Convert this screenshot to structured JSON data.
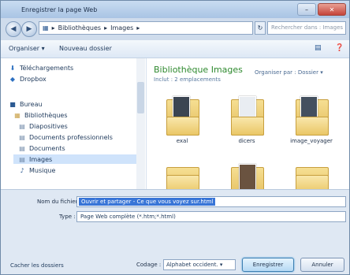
{
  "window": {
    "title": "Enregistrer la page Web"
  },
  "address": {
    "crumbs": [
      "Bibliothèques",
      "Images"
    ],
    "search_placeholder": "Rechercher dans : Images"
  },
  "toolbar": {
    "organize": "Organiser ▾",
    "new_folder": "Nouveau dossier"
  },
  "nav": {
    "items": [
      {
        "label": "Téléchargements",
        "icon": "download-folder-icon"
      },
      {
        "label": "Dropbox",
        "icon": "dropbox-icon"
      },
      {
        "label": "Bureau",
        "icon": "desktop-icon"
      },
      {
        "label": "Bibliothèques",
        "icon": "library-icon"
      },
      {
        "label": "Diapositives",
        "icon": "library-icon"
      },
      {
        "label": "Documents professionnels",
        "icon": "library-icon"
      },
      {
        "label": "Documents",
        "icon": "library-icon"
      },
      {
        "label": "Images",
        "icon": "library-icon"
      },
      {
        "label": "Musique",
        "icon": "music-icon"
      }
    ],
    "selected": "Images"
  },
  "library": {
    "title": "Bibliothèque Images",
    "subtitle": "Inclut : 2 emplacements",
    "arrange_label": "Organiser par :",
    "arrange_value": "Dossier ▾",
    "folders": [
      {
        "label": "exal"
      },
      {
        "label": "dicers"
      },
      {
        "label": "image_voyager"
      },
      {
        "label": ""
      },
      {
        "label": ""
      },
      {
        "label": ""
      }
    ]
  },
  "form": {
    "filename_label": "Nom du fichier :",
    "filename_value": "Ouvrir et partager - Ce que vous voyez sur.html",
    "type_label": "Type :",
    "type_value": "Page Web complète (*.htm;*.html)",
    "hide_folders": "Cacher les dossiers",
    "encoding_label": "Codage :",
    "encoding_value": "Alphabet occident. ▾",
    "save_button": "Enregistrer",
    "cancel_button": "Annuler"
  }
}
